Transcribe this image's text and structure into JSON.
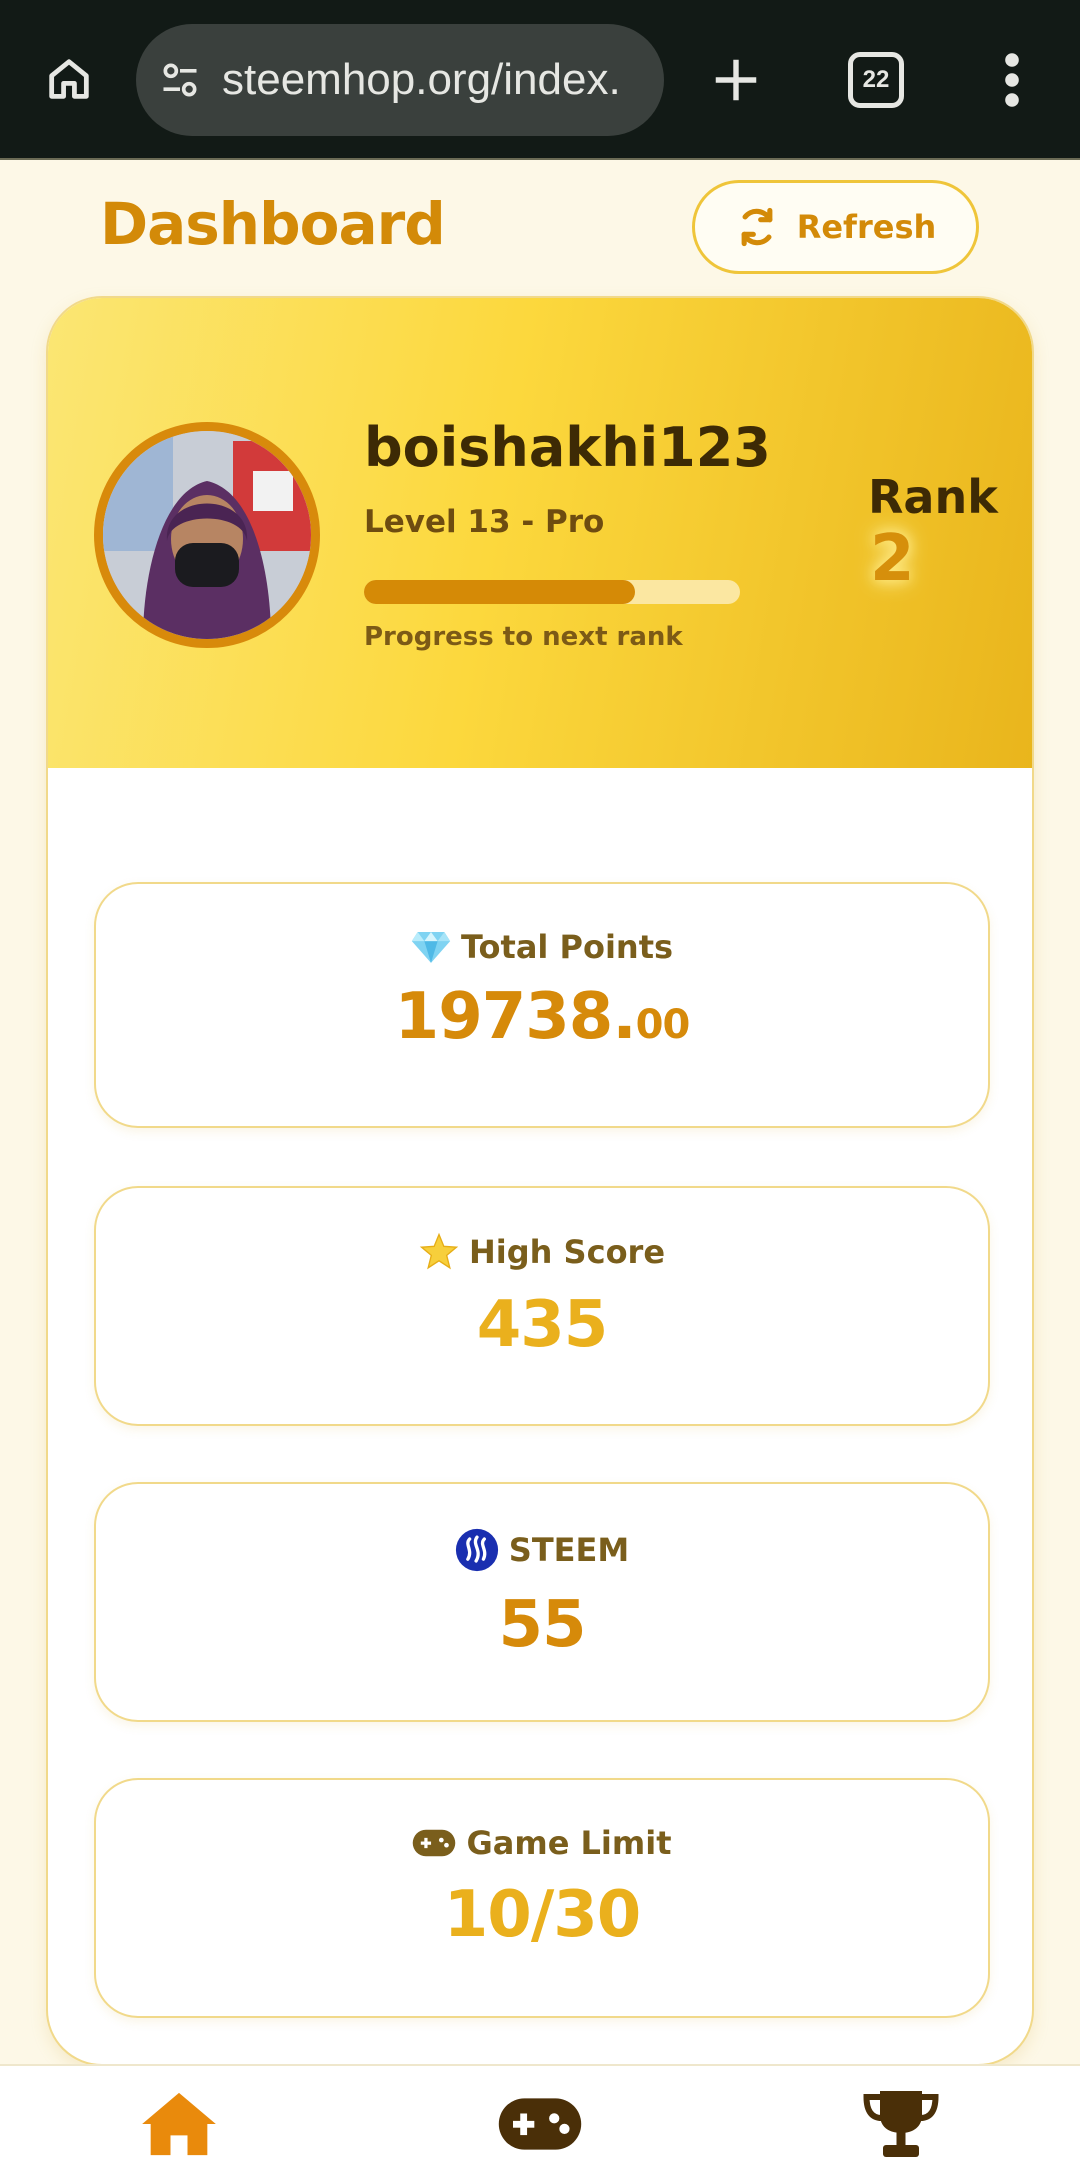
{
  "browser": {
    "url": "steemhop.org/index.",
    "tab_count": "22",
    "icons": [
      "home-icon",
      "site-settings-icon",
      "new-tab-icon",
      "tab-switcher-icon",
      "more-vert-icon"
    ]
  },
  "header": {
    "title": "Dashboard",
    "refresh_label": "Refresh"
  },
  "profile": {
    "username": "boishakhi123",
    "level": "Level 13 - Pro",
    "progress_fraction": 0.72,
    "progress_caption": "Progress to next rank",
    "rank_label": "Rank",
    "rank_value": "2"
  },
  "stats": {
    "total_points": {
      "label": "Total Points",
      "value_int": "19738.",
      "value_dec": "00",
      "icon": "gem-icon"
    },
    "high_score": {
      "label": "High Score",
      "value": "435",
      "icon": "star-icon"
    },
    "steem": {
      "label": "STEEM",
      "value": "55",
      "icon": "steem-logo-icon"
    },
    "game_limit": {
      "label": "Game Limit",
      "value": "10/30",
      "icon": "gamepad-icon"
    }
  },
  "nav": {
    "items": [
      "home-icon",
      "gamepad-icon",
      "trophy-icon"
    ],
    "active": "home-icon"
  },
  "colors": {
    "accent": "#d38a08",
    "gold": "#eab01d",
    "banner_start": "#fbe673",
    "banner_end": "#e9b51c",
    "nav_dark": "#4a2f08"
  }
}
